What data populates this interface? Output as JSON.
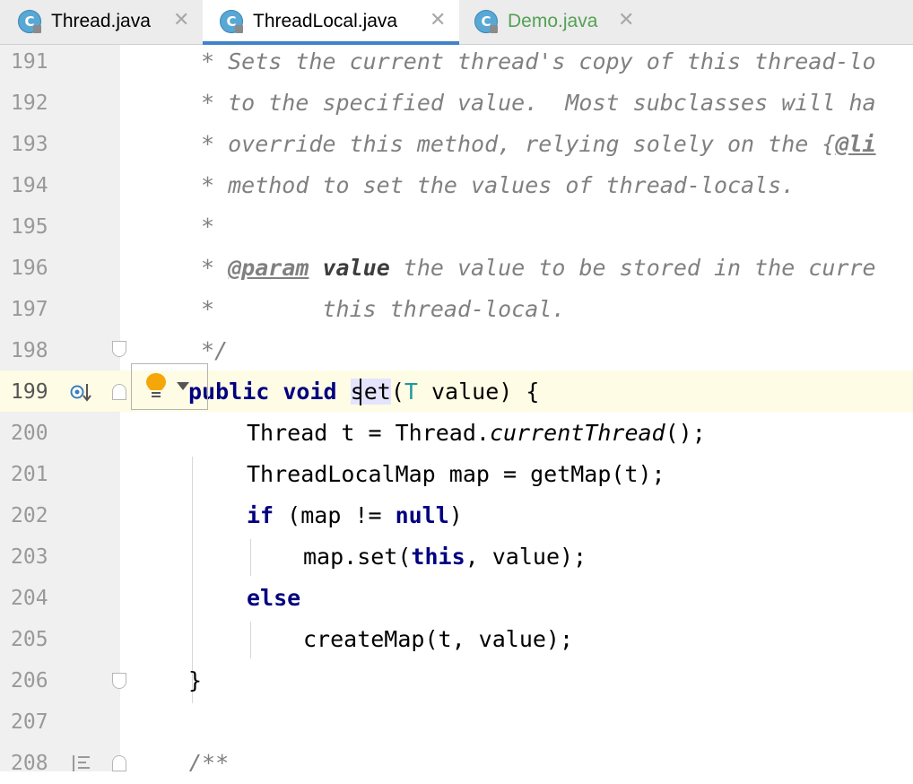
{
  "tabs": [
    {
      "label": "Thread.java",
      "icon_letter": "C",
      "close": "✕",
      "state": "normal"
    },
    {
      "label": "ThreadLocal.java",
      "icon_letter": "C",
      "close": "✕",
      "state": "active"
    },
    {
      "label": "Demo.java",
      "icon_letter": "C",
      "close": "✕",
      "state": "modified"
    }
  ],
  "line_numbers": [
    "191",
    "192",
    "193",
    "194",
    "195",
    "196",
    "197",
    "198",
    "199",
    "200",
    "201",
    "202",
    "203",
    "204",
    "205",
    "206",
    "207",
    "208"
  ],
  "code": {
    "l191": "* Sets the current thread's copy of this thread-lo",
    "l192": "* to the specified value.  Most subclasses will ha",
    "l193a": "* override this method, relying solely on the {",
    "l193b": "@li",
    "l194": "* method to set the values of thread-locals.",
    "l195": "*",
    "l196a": "* ",
    "l196b": "@param",
    "l196c": " ",
    "l196d": "value",
    "l196e": " the value to be stored in the curre",
    "l197": "*        this thread-local.",
    "l198": "*/",
    "l199_kw1": "public",
    "l199_kw2": "void",
    "l199_fn": "set",
    "l199_p1": "(",
    "l199_type": "T",
    "l199_rest": " value) {",
    "l200a": "Thread t = Thread.",
    "l200b": "currentThread",
    "l200c": "();",
    "l201": "ThreadLocalMap map = getMap(t);",
    "l202_kw": "if",
    "l202_mid": " (map != ",
    "l202_null": "null",
    "l202_end": ")",
    "l203a": "map.set(",
    "l203_kw": "this",
    "l203b": ", value);",
    "l204": "else",
    "l205": "createMap(t, value);",
    "l206": "}",
    "l208": "/**"
  },
  "colors": {
    "keyword": "#000080",
    "comment": "#808080",
    "type_param": "#20999d",
    "current_line": "#fefce5",
    "active_tab_underline": "#4083c9"
  },
  "icons": [
    "class-icon",
    "close-icon",
    "implementation-icon",
    "fold-icon",
    "intention-bulb-icon",
    "dropdown-arrow-icon",
    "overrides-icon"
  ]
}
